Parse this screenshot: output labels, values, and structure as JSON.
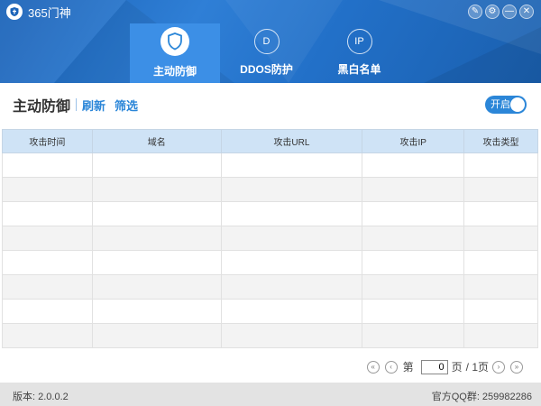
{
  "app": {
    "title": "365门神"
  },
  "window_controls": [
    "✎",
    "⚙",
    "—",
    "✕"
  ],
  "tabs": [
    {
      "label": "主动防御",
      "icon": "shield-icon",
      "active": true
    },
    {
      "label": "DDOS防护",
      "icon": "D",
      "active": false
    },
    {
      "label": "黑白名单",
      "icon": "IP",
      "active": false
    }
  ],
  "toolbar": {
    "title": "主动防御",
    "refresh_label": "刷新",
    "filter_label": "筛选",
    "toggle_label": "开启"
  },
  "table": {
    "headers": [
      "攻击时间",
      "域名",
      "攻击URL",
      "攻击IP",
      "攻击类型"
    ],
    "rows": [
      [
        "",
        "",
        "",
        "",
        ""
      ],
      [
        "",
        "",
        "",
        "",
        ""
      ],
      [
        "",
        "",
        "",
        "",
        ""
      ],
      [
        "",
        "",
        "",
        "",
        ""
      ],
      [
        "",
        "",
        "",
        "",
        ""
      ],
      [
        "",
        "",
        "",
        "",
        ""
      ],
      [
        "",
        "",
        "",
        "",
        ""
      ],
      [
        "",
        "",
        "",
        "",
        ""
      ]
    ]
  },
  "pager": {
    "page_prefix": "第",
    "current_page": "0",
    "page_suffix": "页",
    "total": "/ 1页"
  },
  "statusbar": {
    "version": "版本: 2.0.0.2",
    "qq_group": "官方QQ群: 259982286"
  },
  "colors": {
    "accent": "#2b86d8",
    "header_bg": "#1b63b8",
    "active_tab": "#3c8fe6",
    "table_header": "#cfe3f6"
  }
}
